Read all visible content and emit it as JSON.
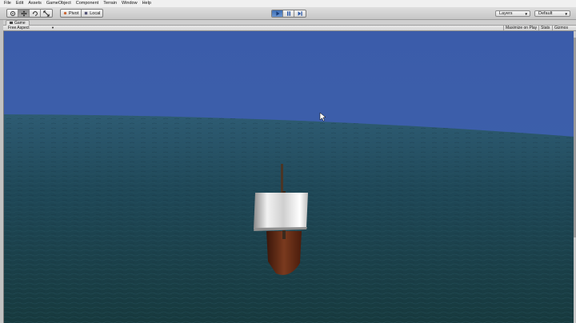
{
  "menu": [
    "File",
    "Edit",
    "Assets",
    "GameObject",
    "Component",
    "Terrain",
    "Window",
    "Help"
  ],
  "toolbar": {
    "tools": [
      "hand-icon",
      "move-icon",
      "rotate-icon",
      "scale-icon"
    ],
    "pivot_label": "Pivot",
    "local_label": "Local",
    "play_controls": [
      "play-icon",
      "pause-icon",
      "step-icon"
    ],
    "layers_label": "Layers",
    "layout_label": "Default"
  },
  "game_tab": {
    "label": "Game",
    "icon": "game-view-icon"
  },
  "game_bar": {
    "aspect_label": "Free Aspect",
    "maximize_label": "Maximize on Play",
    "stats_label": "Stats",
    "gizmos_label": "Gizmos"
  },
  "scene": {
    "sky_color": "#3d5fa8",
    "sea_color": "#1e4050",
    "sail_color": "#d9d9d9",
    "hull_color": "#6b2e18"
  }
}
